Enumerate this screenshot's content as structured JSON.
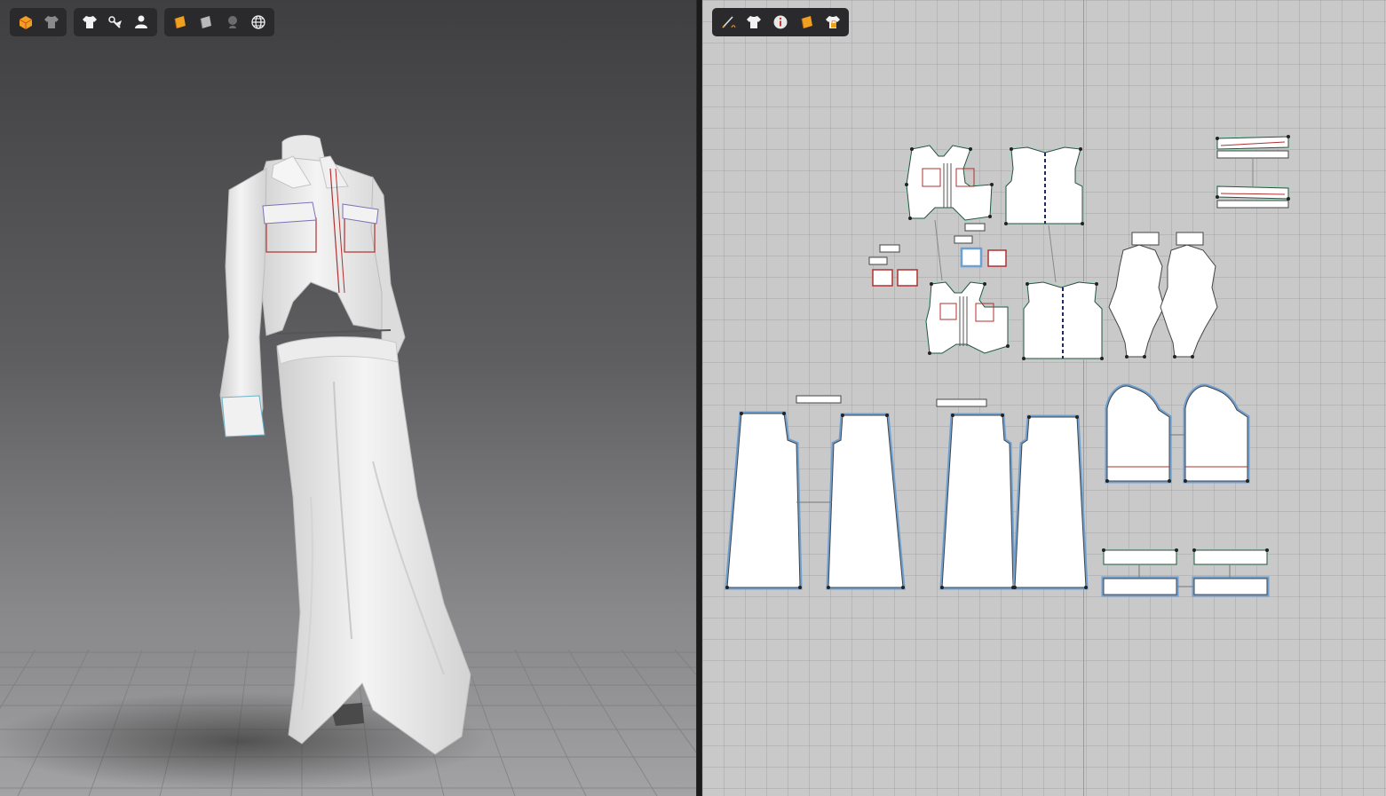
{
  "app": {
    "accent": "#6fa0d2",
    "background_3d": "#5e5e60",
    "background_2d": "#c9c9c9"
  },
  "toolbar_3d": {
    "groups": [
      {
        "items": [
          {
            "icon": "avatar-display-icon"
          },
          {
            "icon": "garment-display-icon"
          }
        ]
      },
      {
        "items": [
          {
            "icon": "show-garment-icon"
          },
          {
            "icon": "show-pins-icon"
          },
          {
            "icon": "show-avatar-icon"
          }
        ]
      },
      {
        "items": [
          {
            "icon": "texture-surface-icon"
          },
          {
            "icon": "shaded-surface-icon"
          },
          {
            "icon": "ghost-avatar-icon"
          },
          {
            "icon": "mesh-globe-icon"
          }
        ]
      }
    ]
  },
  "toolbar_2d": {
    "items": [
      {
        "icon": "pen-icon"
      },
      {
        "icon": "garment-icon"
      },
      {
        "icon": "info-icon"
      },
      {
        "icon": "texture-icon"
      },
      {
        "icon": "lock-garment-icon"
      }
    ]
  },
  "colors": {
    "stitch_red": "#b03030",
    "seam_green": "#9fdcc0",
    "selection_blue": "#6fa0d2",
    "point": "#222222"
  }
}
